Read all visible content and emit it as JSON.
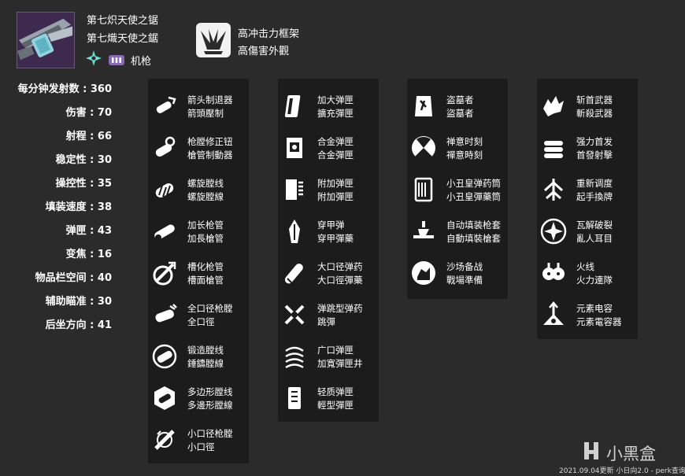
{
  "weapon": {
    "name_simplified": "第七炽天使之锯",
    "name_traditional": "第七熾天使之鋸",
    "element_icon": "strand-icon",
    "ammo_icon": "heavy-ammo-icon",
    "type": "机枪",
    "frame_icon": "high-impact-frame-icon",
    "frame_simplified": "高冲击力框架",
    "frame_traditional": "高傷害外觀"
  },
  "stats": [
    {
      "label": "每分钟发射数",
      "value": "360"
    },
    {
      "label": "伤害",
      "value": "70"
    },
    {
      "label": "射程",
      "value": "66"
    },
    {
      "label": "稳定性",
      "value": "30"
    },
    {
      "label": "操控性",
      "value": "35"
    },
    {
      "label": "填装速度",
      "value": "38"
    },
    {
      "label": "弹匣",
      "value": "43"
    },
    {
      "label": "变焦",
      "value": "16"
    },
    {
      "label": "物品栏空间",
      "value": "40"
    },
    {
      "label": "辅助瞄准",
      "value": "30"
    },
    {
      "label": "后坐方向",
      "value": "41"
    }
  ],
  "columns": [
    {
      "name": "barrels",
      "perks": [
        {
          "icon": "arrowhead-brake-icon",
          "zh_s": "箭头制退器",
          "zh_t": "箭頭壓制"
        },
        {
          "icon": "compensator-icon",
          "zh_s": "枪膛修正钮",
          "zh_t": "槍管制動器"
        },
        {
          "icon": "corkscrew-rifling-icon",
          "zh_s": "螺旋膛线",
          "zh_t": "螺旋膛線"
        },
        {
          "icon": "extended-barrel-icon",
          "zh_s": "加长枪管",
          "zh_t": "加長槍管"
        },
        {
          "icon": "fluted-barrel-icon",
          "zh_s": "槽化枪管",
          "zh_t": "槽面槍管"
        },
        {
          "icon": "full-bore-icon",
          "zh_s": "全口径枪膛",
          "zh_t": "全口徑"
        },
        {
          "icon": "hammer-forged-rifling-icon",
          "zh_s": "锻造膛线",
          "zh_t": "錘鑄膛線"
        },
        {
          "icon": "polygonal-rifling-icon",
          "zh_s": "多边形膛线",
          "zh_t": "多邊形膛線"
        },
        {
          "icon": "smallbore-icon",
          "zh_s": "小口径枪膛",
          "zh_t": "小口徑"
        }
      ]
    },
    {
      "name": "magazines",
      "perks": [
        {
          "icon": "extended-mag-icon",
          "zh_s": "加大弹匣",
          "zh_t": "擴充彈匣"
        },
        {
          "icon": "alloy-magazine-icon",
          "zh_s": "合金弹匣",
          "zh_t": "合金彈匣"
        },
        {
          "icon": "appended-mag-icon",
          "zh_s": "附加弹匣",
          "zh_t": "附加彈匣"
        },
        {
          "icon": "armor-piercing-rounds-icon",
          "zh_s": "穿甲弹",
          "zh_t": "穿甲彈藥"
        },
        {
          "icon": "high-caliber-rounds-icon",
          "zh_s": "大口径弹药",
          "zh_t": "大口徑彈藥"
        },
        {
          "icon": "ricochet-rounds-icon",
          "zh_s": "弹跳型弹药",
          "zh_t": "跳彈"
        },
        {
          "icon": "flared-magwell-icon",
          "zh_s": "广口弹匣",
          "zh_t": "加寬彈匣井"
        },
        {
          "icon": "light-mag-icon",
          "zh_s": "轻质弹匣",
          "zh_t": "輕型彈匣"
        }
      ]
    },
    {
      "name": "trait1",
      "perks": [
        {
          "icon": "grave-robber-icon",
          "zh_s": "盗墓者",
          "zh_t": "盜墓者"
        },
        {
          "icon": "zen-moment-icon",
          "zh_s": "禅意时刻",
          "zh_t": "禪意時刻"
        },
        {
          "icon": "clown-cartridge-icon",
          "zh_s": "小丑皇弹药筒",
          "zh_t": "小丑皇彈藥筒"
        },
        {
          "icon": "auto-loading-holster-icon",
          "zh_s": "自动填装枪套",
          "zh_t": "自動填裝槍套"
        },
        {
          "icon": "field-prep-icon",
          "zh_s": "沙场备战",
          "zh_t": "戰場準備"
        }
      ]
    },
    {
      "name": "trait2",
      "perks": [
        {
          "icon": "headseeker-icon",
          "zh_s": "斩首武器",
          "zh_t": "斬殺武器"
        },
        {
          "icon": "opening-shot-icon",
          "zh_s": "强力首发",
          "zh_t": "首發射擊"
        },
        {
          "icon": "redirection-icon",
          "zh_s": "重新调度",
          "zh_t": "起手換牌"
        },
        {
          "icon": "unravel-icon",
          "zh_s": "瓦解破裂",
          "zh_t": "亂人耳目"
        },
        {
          "icon": "firefly-icon",
          "zh_s": "火线",
          "zh_t": "火力連隊"
        },
        {
          "icon": "elemental-capacitor-icon",
          "zh_s": "元素电容",
          "zh_t": "元素電容器"
        }
      ]
    }
  ],
  "watermark": {
    "icon": "xiaoheihe-logo-icon",
    "text": "小黑盒"
  },
  "footer": "2021.09.04更新 小日向2.0 - perk查询"
}
